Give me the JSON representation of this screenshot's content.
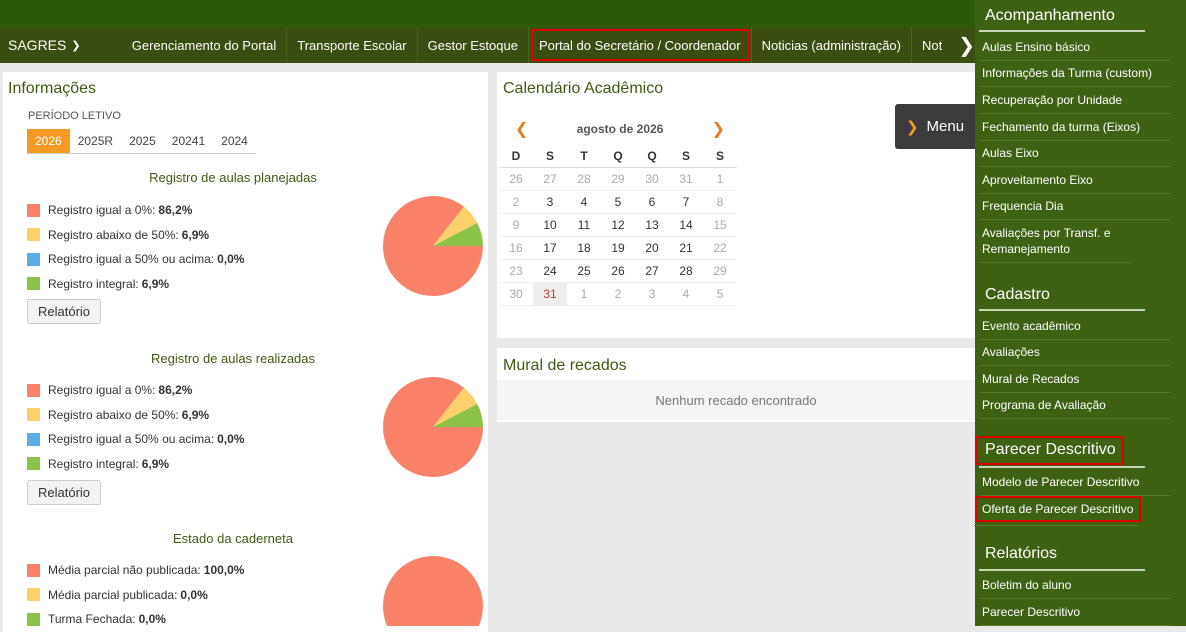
{
  "navbar": {
    "brand": "SAGRES",
    "items": [
      "Gerenciamento do Portal",
      "Transporte Escolar",
      "Gestor Estoque",
      "Portal do Secretário / Coordenador",
      "Noticias (administração)"
    ],
    "more": "Not"
  },
  "info": {
    "title": "Informações",
    "periodo_label": "PERÍODO LETIVO",
    "tabs": [
      "2026",
      "2025R",
      "2025",
      "20241",
      "2024"
    ],
    "sections": [
      {
        "title": "Registro de aulas planejadas",
        "legend": [
          {
            "label": "Registro igual a 0%:",
            "value": "86,2%"
          },
          {
            "label": "Registro abaixo de 50%:",
            "value": "6,9%"
          },
          {
            "label": "Registro igual a 50% ou acima:",
            "value": "0,0%"
          },
          {
            "label": "Registro integral:",
            "value": "6,9%"
          }
        ],
        "button": "Relatório"
      },
      {
        "title": "Registro de aulas realizadas",
        "legend": [
          {
            "label": "Registro igual a 0%:",
            "value": "86,2%"
          },
          {
            "label": "Registro abaixo de 50%:",
            "value": "6,9%"
          },
          {
            "label": "Registro igual a 50% ou acima:",
            "value": "0,0%"
          },
          {
            "label": "Registro integral:",
            "value": "6,9%"
          }
        ],
        "button": "Relatório"
      },
      {
        "title": "Estado da caderneta",
        "legend": [
          {
            "label": "Média parcial não publicada:",
            "value": "100,0%"
          },
          {
            "label": "Média parcial publicada:",
            "value": "0,0%"
          },
          {
            "label": "Turma Fechada:",
            "value": "0,0%"
          }
        ]
      }
    ],
    "colors": {
      "red": "#fa8269",
      "yellow": "#fcd16b",
      "blue": "#5dade2",
      "green": "#8bc34a"
    }
  },
  "calendar": {
    "title": "Calendário Acadêmico",
    "month": "agosto de 2026",
    "weekdays": [
      "D",
      "S",
      "T",
      "Q",
      "Q",
      "S",
      "S"
    ],
    "weeks": [
      [
        "26",
        "27",
        "28",
        "29",
        "30",
        "31",
        "1"
      ],
      [
        "2",
        "3",
        "4",
        "5",
        "6",
        "7",
        "8"
      ],
      [
        "9",
        "10",
        "11",
        "12",
        "13",
        "14",
        "15"
      ],
      [
        "16",
        "17",
        "18",
        "19",
        "20",
        "21",
        "22"
      ],
      [
        "23",
        "24",
        "25",
        "26",
        "27",
        "28",
        "29"
      ],
      [
        "30",
        "31",
        "1",
        "2",
        "3",
        "4",
        "5"
      ]
    ]
  },
  "menu_button": "Menu",
  "mural": {
    "title": "Mural de recados",
    "empty": "Nenhum recado encontrado"
  },
  "sidebar": {
    "acompanhamento": {
      "title": "Acompanhamento",
      "items": [
        "Aulas Ensino básico",
        "Informações da Turma (custom)",
        "Recuperação por Unidade",
        "Fechamento da turma (Eixos)",
        "Aulas Eixo",
        "Aproveitamento Eixo",
        "Frequencia Dia",
        "Avaliações por Transf. e Remanejamento"
      ]
    },
    "cadastro": {
      "title": "Cadastro",
      "items": [
        "Evento acadêmico",
        "Avaliações",
        "Mural de Recados",
        "Programa de Avaliação"
      ]
    },
    "parecer": {
      "title": "Parecer Descritivo",
      "items": [
        "Modelo de Parecer Descritivo",
        "Oferta de Parecer Descritivo"
      ]
    },
    "relatorios": {
      "title": "Relatórios",
      "items": [
        "Boletim do aluno",
        "Parecer Descritivo"
      ]
    }
  }
}
